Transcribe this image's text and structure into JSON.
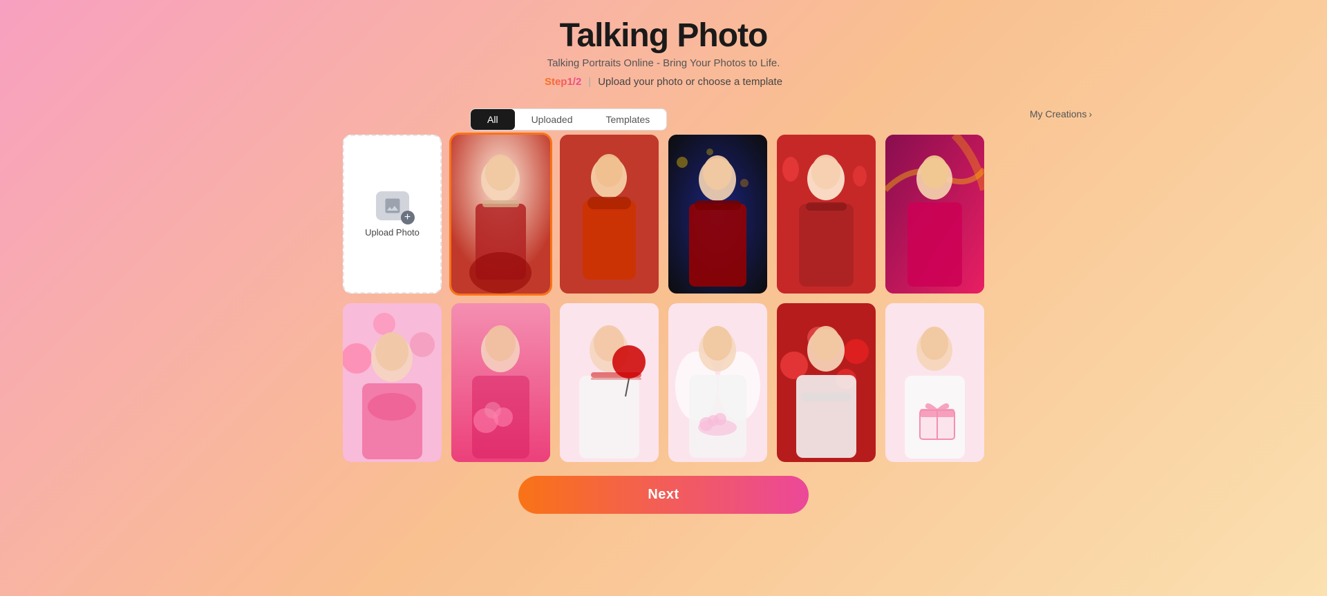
{
  "header": {
    "title": "Talking Photo",
    "subtitle": "Talking Portraits Online - Bring Your Photos to Life.",
    "step_label": "Step1/2",
    "step_divider": "|",
    "step_instruction": "Upload your photo or choose a template"
  },
  "tabs": [
    {
      "id": "all",
      "label": "All",
      "active": true
    },
    {
      "id": "uploaded",
      "label": "Uploaded",
      "active": false
    },
    {
      "id": "templates",
      "label": "Templates",
      "active": false
    }
  ],
  "my_creations_label": "My Creations",
  "upload_card": {
    "label": "Upload Photo",
    "plus": "+"
  },
  "photos": [
    {
      "id": 1,
      "bg": "p1",
      "alt": "Woman in red Chinese dress"
    },
    {
      "id": 2,
      "bg": "p2",
      "alt": "Man in red scarf smiling"
    },
    {
      "id": 3,
      "bg": "p3",
      "alt": "Woman in red sequin scarf at night"
    },
    {
      "id": 4,
      "bg": "p4",
      "alt": "Woman smiling with red lanterns"
    },
    {
      "id": 5,
      "bg": "p5",
      "alt": "Man smiling with Chinese dragon"
    },
    {
      "id": 6,
      "bg": "p6",
      "alt": "Woman with pink roses and balloons"
    },
    {
      "id": 7,
      "bg": "p7",
      "alt": "Woman with pink flowers"
    },
    {
      "id": 8,
      "bg": "p8",
      "alt": "Man with red balloon and suspenders"
    },
    {
      "id": 9,
      "bg": "p9",
      "alt": "Man with angel wings holding flowers"
    },
    {
      "id": 10,
      "bg": "p10",
      "alt": "Man with balloons crossing arms"
    },
    {
      "id": 11,
      "bg": "p11",
      "alt": "Man holding pink gift box"
    }
  ],
  "next_button_label": "Next",
  "colors": {
    "accent_gradient_start": "#f97316",
    "accent_gradient_end": "#ec4899",
    "active_tab_bg": "#1a1a1a",
    "active_tab_text": "#ffffff"
  }
}
